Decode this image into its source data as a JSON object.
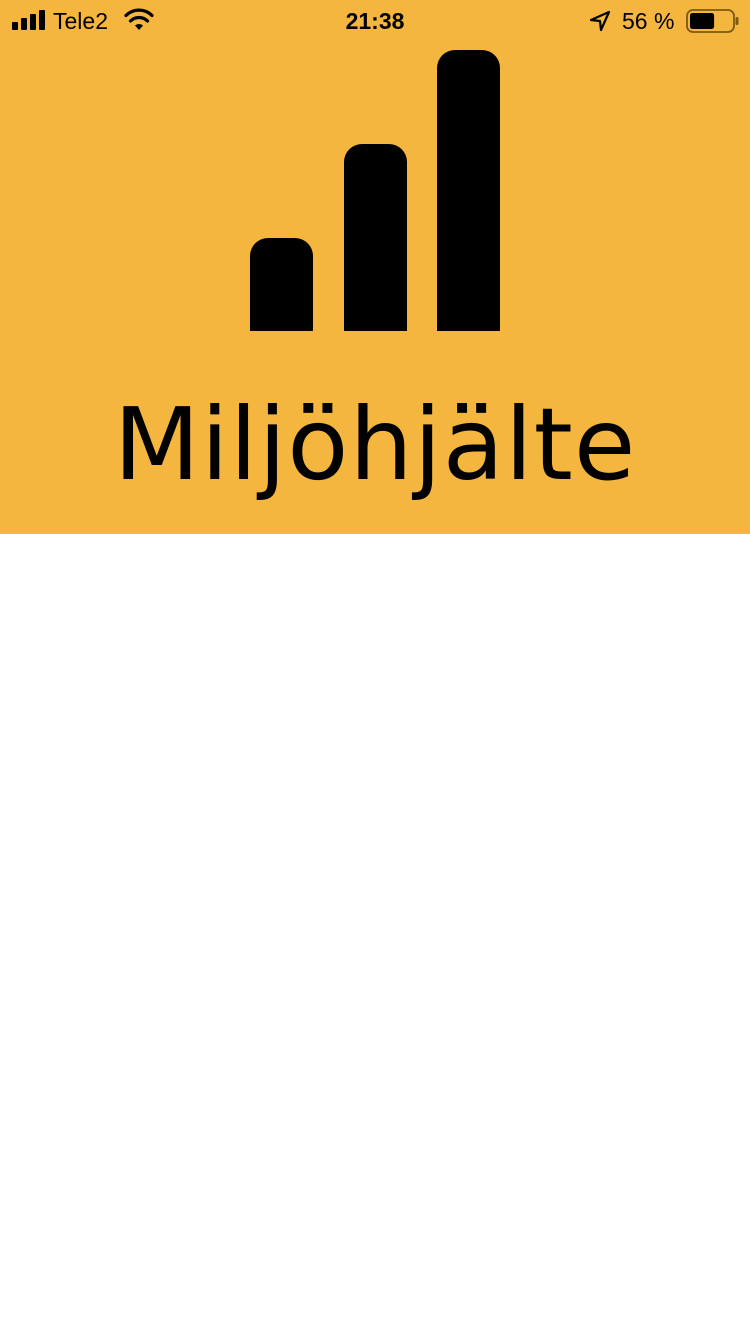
{
  "colors": {
    "header_background": "#F4B63F",
    "foreground": "#000000",
    "page_background": "#FFFFFF"
  },
  "status_bar": {
    "carrier": "Tele2",
    "time": "21:38",
    "battery_percent": "56 %",
    "battery_level": 0.56,
    "icons": [
      "signal-icon",
      "wifi-icon",
      "location-arrow-icon",
      "battery-icon"
    ]
  },
  "header": {
    "logo_icon": "bar-chart-logo-icon",
    "app_name": "Miljöhjälte"
  }
}
